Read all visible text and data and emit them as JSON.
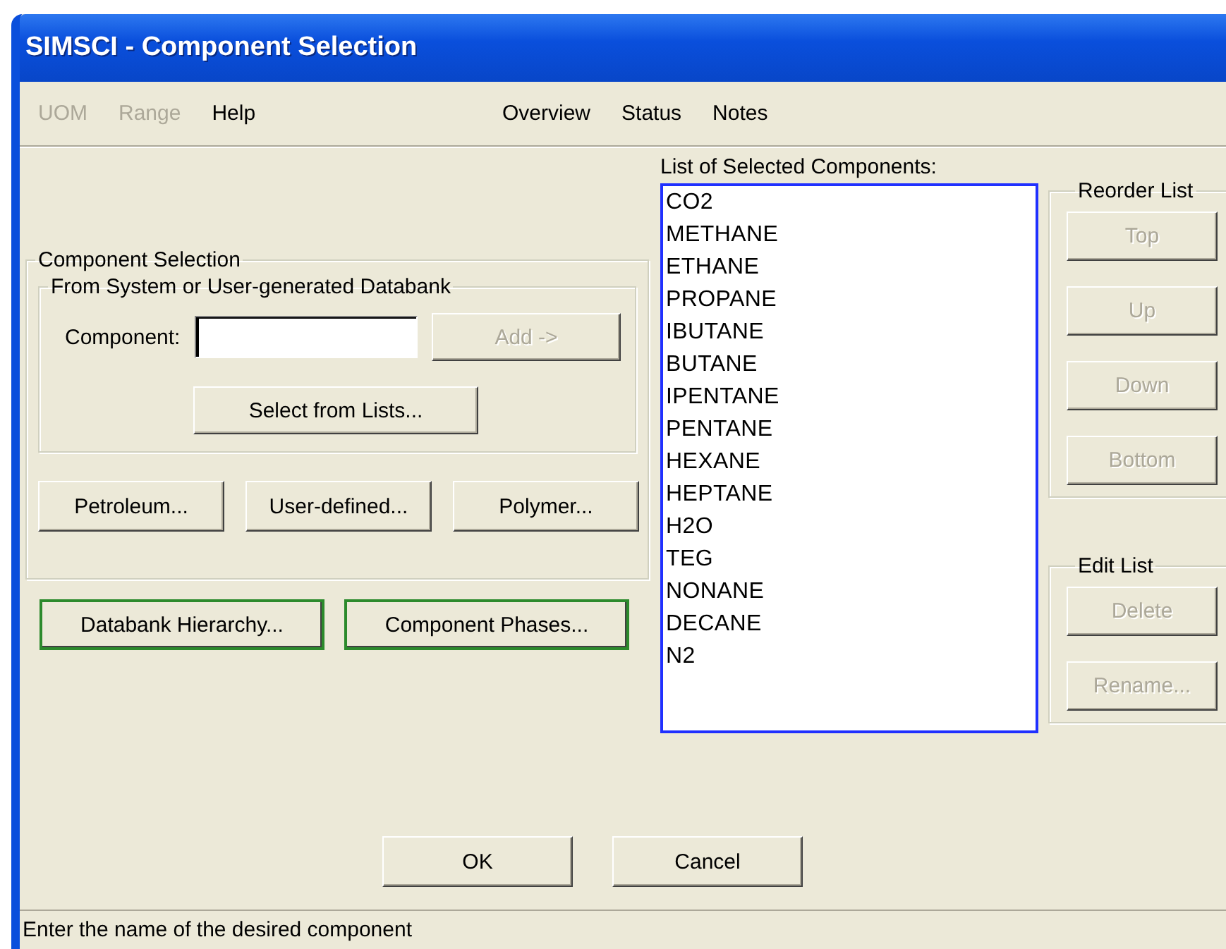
{
  "window": {
    "title": "SIMSCI - Component Selection"
  },
  "menu": {
    "left": [
      {
        "label": "UOM",
        "disabled": true
      },
      {
        "label": "Range",
        "disabled": true
      },
      {
        "label": "Help",
        "disabled": false
      }
    ],
    "right": [
      {
        "label": "Overview",
        "disabled": false
      },
      {
        "label": "Status",
        "disabled": false
      },
      {
        "label": "Notes",
        "disabled": false
      }
    ]
  },
  "component_selection": {
    "title": "Component Selection",
    "databank_group": {
      "title": "From System or User-generated Databank",
      "component_label": "Component:",
      "add_button": {
        "label": "Add ->",
        "disabled": true
      },
      "select_button": {
        "label": "Select from Lists...",
        "disabled": false
      }
    },
    "buttons": [
      {
        "label": "Petroleum...",
        "disabled": false
      },
      {
        "label": "User-defined...",
        "disabled": false
      },
      {
        "label": "Polymer...",
        "disabled": false
      }
    ]
  },
  "extra_buttons": [
    {
      "label": "Databank Hierarchy...",
      "highlighted": true
    },
    {
      "label": "Component Phases...",
      "highlighted": true
    }
  ],
  "selected_list": {
    "label": "List of Selected Components:",
    "items": [
      "CO2",
      "METHANE",
      "ETHANE",
      "PROPANE",
      "IBUTANE",
      "BUTANE",
      "IPENTANE",
      "PENTANE",
      "HEXANE",
      "HEPTANE",
      "H2O",
      "TEG",
      "NONANE",
      "DECANE",
      "N2"
    ]
  },
  "reorder_list": {
    "title": "Reorder List",
    "buttons": [
      {
        "label": "Top",
        "disabled": true
      },
      {
        "label": "Up",
        "disabled": true
      },
      {
        "label": "Down",
        "disabled": true
      },
      {
        "label": "Bottom",
        "disabled": true
      }
    ]
  },
  "edit_list": {
    "title": "Edit List",
    "buttons": [
      {
        "label": "Delete",
        "disabled": true
      },
      {
        "label": "Rename...",
        "disabled": true
      }
    ]
  },
  "dialog_buttons": [
    {
      "label": "OK",
      "disabled": false
    },
    {
      "label": "Cancel",
      "disabled": false
    }
  ],
  "status_bar": {
    "text": "Enter the name of the desired component"
  }
}
